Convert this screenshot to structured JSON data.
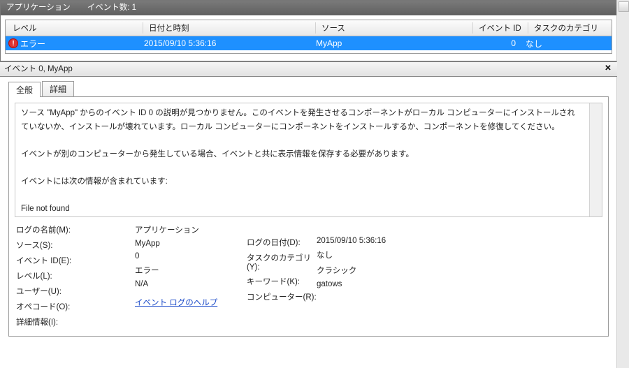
{
  "header": {
    "log_name": "アプリケーション",
    "event_count_label": "イベント数: 1"
  },
  "grid": {
    "columns": {
      "level": "レベル",
      "datetime": "日付と時刻",
      "source": "ソース",
      "event_id": "イベント ID",
      "category": "タスクのカテゴリ"
    },
    "rows": [
      {
        "level": "エラー",
        "datetime": "2015/09/10 5:36:16",
        "source": "MyApp",
        "event_id": "0",
        "category": "なし"
      }
    ]
  },
  "detail": {
    "title": "イベント 0, MyApp",
    "tabs": {
      "general": "全般",
      "details": "詳細"
    },
    "description": {
      "line1": "ソース \"MyApp\" からのイベント ID 0 の説明が見つかりません。このイベントを発生させるコンポーネントがローカル コンピューターにインストールされていないか、インストールが壊れています。ローカル コンピューターにコンポーネントをインストールするか、コンポーネントを修復してください。",
      "line2": "イベントが別のコンピューターから発生している場合、イベントと共に表示情報を保存する必要があります。",
      "line3": "イベントには次の情報が含まれています:",
      "info": "File not found"
    },
    "kv": {
      "labels": {
        "log_name": "ログの名前(M):",
        "source": "ソース(S):",
        "event_id": "イベント ID(E):",
        "level": "レベル(L):",
        "user": "ユーザー(U):",
        "opcode": "オペコード(O):",
        "more_info": "詳細情報(I):",
        "logged": "ログの日付(D):",
        "task_cat": "タスクのカテゴリ(Y):",
        "keywords": "キーワード(K):",
        "computer": "コンピューター(R):"
      },
      "values": {
        "log_name": "アプリケーション",
        "source": "MyApp",
        "event_id": "0",
        "level": "エラー",
        "user": "N/A",
        "opcode": "",
        "more_info": "イベント ログのヘルプ",
        "logged": "2015/09/10 5:36:16",
        "task_cat": "なし",
        "keywords": "クラシック",
        "computer": "gatows"
      }
    }
  }
}
